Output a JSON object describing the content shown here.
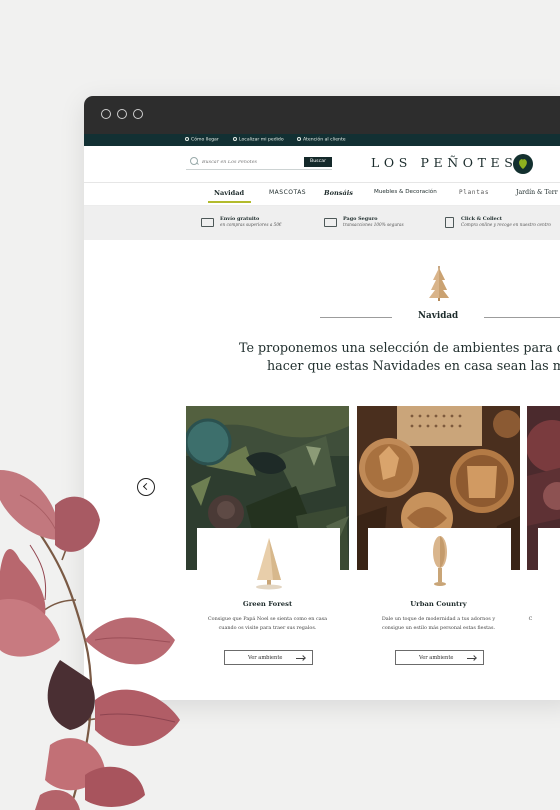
{
  "topbar": {
    "links": [
      "Cómo llegar",
      "Localizar mi pedido",
      "Atención al cliente"
    ]
  },
  "header": {
    "search_placeholder": "Buscar en Los Peñotes",
    "search_button": "Buscar",
    "logo_text": "LOS PEÑOTES"
  },
  "nav": {
    "items": [
      "Navidad",
      "MASCOTAS",
      "Bonsáis",
      "Muebles & Decoración",
      "Plantas",
      "Jardín & Terr"
    ]
  },
  "benefits": [
    {
      "title": "Envío gratuito",
      "subtitle": "en compras superiores a 50€"
    },
    {
      "title": "Pago Seguro",
      "subtitle": "transacciones 100% seguras"
    },
    {
      "title": "Click & Collect",
      "subtitle": "Compra online y recoge en nuestro centro"
    }
  ],
  "section": {
    "title": "Navidad",
    "headline_1": "Te proponemos una selección de ambientes para deco",
    "headline_2": "hacer que estas Navidades en casa sean las más es"
  },
  "cards": [
    {
      "title": "Green Forest",
      "desc_1": "Consigue que Papá Noel se sienta como en casa",
      "desc_2": "cuando os visite para traer sus regalos.",
      "button": "Ver ambiente"
    },
    {
      "title": "Urban Country",
      "desc_1": "Dale un toque de modernidad a tus adornos y",
      "desc_2": "consigue un estilo más personal estas fiestas.",
      "button": "Ver ambiente"
    },
    {
      "title": "",
      "desc_1": "C",
      "desc_2": "",
      "button": ""
    }
  ],
  "colors": {
    "topbar": "#123033",
    "accent_underline": "#b2bb2d",
    "titlebar": "#2d2d2d",
    "logo_leaf": "#8fb21f"
  }
}
